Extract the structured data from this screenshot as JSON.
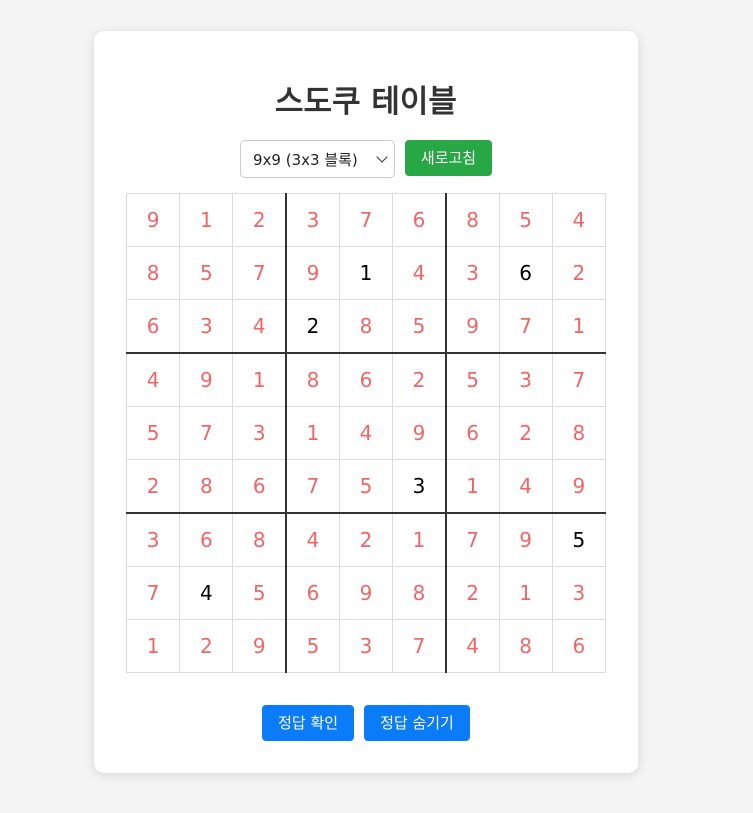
{
  "title": "스도쿠 테이블",
  "size_select": {
    "selected": "9x9 (3x3 블록)"
  },
  "buttons": {
    "refresh": "새로고침",
    "check_answer": "정답 확인",
    "hide_answer": "정답 숨기기"
  },
  "colors": {
    "answer": "#f06666",
    "given": "#000000",
    "refresh_bg": "#28a745",
    "action_bg": "#0a7cf7"
  },
  "board": {
    "values": [
      [
        9,
        1,
        2,
        3,
        7,
        6,
        8,
        5,
        4
      ],
      [
        8,
        5,
        7,
        9,
        1,
        4,
        3,
        6,
        2
      ],
      [
        6,
        3,
        4,
        2,
        8,
        5,
        9,
        7,
        1
      ],
      [
        4,
        9,
        1,
        8,
        6,
        2,
        5,
        3,
        7
      ],
      [
        5,
        7,
        3,
        1,
        4,
        9,
        6,
        2,
        8
      ],
      [
        2,
        8,
        6,
        7,
        5,
        3,
        1,
        4,
        9
      ],
      [
        3,
        6,
        8,
        4,
        2,
        1,
        7,
        9,
        5
      ],
      [
        7,
        4,
        5,
        6,
        9,
        8,
        2,
        1,
        3
      ],
      [
        1,
        2,
        9,
        5,
        3,
        7,
        4,
        8,
        6
      ]
    ],
    "given": [
      [
        0,
        0,
        0,
        0,
        0,
        0,
        0,
        0,
        0
      ],
      [
        0,
        0,
        0,
        0,
        1,
        0,
        0,
        1,
        0
      ],
      [
        0,
        0,
        0,
        1,
        0,
        0,
        0,
        0,
        0
      ],
      [
        0,
        0,
        0,
        0,
        0,
        0,
        0,
        0,
        0
      ],
      [
        0,
        0,
        0,
        0,
        0,
        0,
        0,
        0,
        0
      ],
      [
        0,
        0,
        0,
        0,
        0,
        1,
        0,
        0,
        0
      ],
      [
        0,
        0,
        0,
        0,
        0,
        0,
        0,
        0,
        1
      ],
      [
        0,
        1,
        0,
        0,
        0,
        0,
        0,
        0,
        0
      ],
      [
        0,
        0,
        0,
        0,
        0,
        0,
        0,
        0,
        0
      ]
    ]
  }
}
